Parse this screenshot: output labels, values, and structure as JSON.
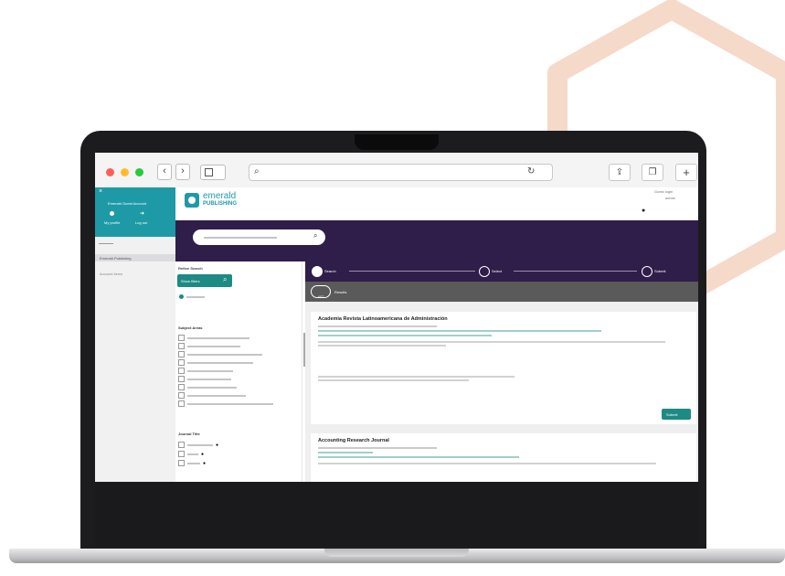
{
  "colors": {
    "teal": "#1e9aa6",
    "purple": "#2f1d4a",
    "green_button": "#1e8a84",
    "hexagon": "#f5d9c9",
    "laptop": "#1c1c1e"
  },
  "decoration": {
    "shape": "hexagon-outline"
  },
  "browser": {
    "back_glyph": "‹",
    "forward_glyph": "›",
    "reload_glyph": "↻",
    "share_glyph": "⇪",
    "tabs_glyph": "❐",
    "add_tab_glyph": "+"
  },
  "sidebar": {
    "user_lines": [
      "Emerald Guest Account"
    ],
    "actions": [
      "My profile",
      "Log out"
    ],
    "items": [
      "Emerald Publishing",
      "Account items"
    ]
  },
  "header": {
    "logo_line1": "emerald",
    "logo_line2": "PUBLISHING",
    "account_line1": "Guest login",
    "account_line2": "admin"
  },
  "search": {
    "placeholder": ""
  },
  "filters": {
    "title": "Refine Search",
    "button_label": "Show filters",
    "subject_title": "Subject Areas",
    "subject_items": 9,
    "journal_title": "Journal Title",
    "journal_items": 3
  },
  "stepper": {
    "steps": [
      "Search",
      "Select",
      "Submit"
    ]
  },
  "results": {
    "count": "407",
    "label": "Results",
    "items": [
      {
        "title": "Academia Revista Latinoamericana de Administración",
        "button": "Submit"
      },
      {
        "title": "Accounting Research Journal"
      }
    ]
  }
}
